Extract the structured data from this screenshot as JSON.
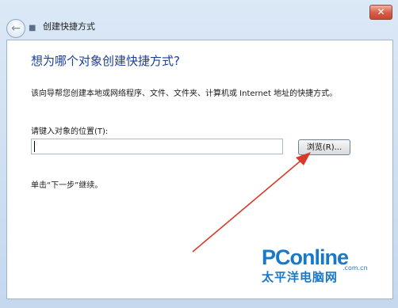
{
  "window": {
    "title": "创建快捷方式",
    "close_label": "✕"
  },
  "wizard": {
    "heading": "想为哪个对象创建快捷方式?",
    "description": "该向导帮您创建本地或网络程序、文件、文件夹、计算机或 Internet 地址的快捷方式。",
    "location_label": "请键入对象的位置(T):",
    "location_value": "",
    "browse_label": "浏览(R)...",
    "next_hint": "单击“下一步”继续。"
  },
  "icons": {
    "back": "back-arrow-icon",
    "wizard": "shortcut-wizard-icon",
    "close": "close-icon"
  },
  "colors": {
    "heading": "#1b3f9a",
    "annotation_arrow": "#d83a2a",
    "watermark": "#1a78c6"
  },
  "watermark": {
    "brand": "PConline",
    "domain": ".com.cn",
    "chinese": "太平洋电脑网"
  }
}
